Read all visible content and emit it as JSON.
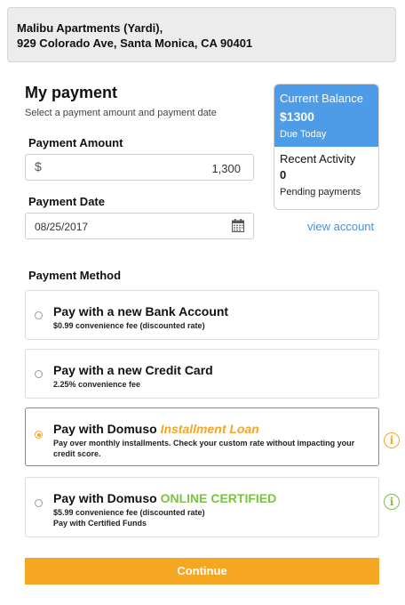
{
  "property": {
    "line1": "Malibu Apartments (Yardi),",
    "line2": "929 Colorado Ave, Santa Monica, CA 90401"
  },
  "payment": {
    "title": "My payment",
    "subtitle": "Select a payment amount and payment date",
    "amount_label": "Payment Amount",
    "currency_symbol": "$",
    "amount_value": "1,300",
    "date_label": "Payment Date",
    "date_value": "08/25/2017"
  },
  "balance": {
    "current_label": "Current Balance",
    "current_value": "$1300",
    "due_text": "Due Today",
    "recent_label": "Recent Activity",
    "recent_value": "0",
    "pending_text": "Pending payments",
    "view_link": "view account"
  },
  "method": {
    "label": "Payment Method",
    "options": [
      {
        "title": "Pay with a new Bank Account",
        "desc": "$0.99 convenience fee (discounted rate)",
        "selected": false
      },
      {
        "title": "Pay with a new Credit Card",
        "desc": "2.25% convenience fee",
        "selected": false
      },
      {
        "title_prefix": "Pay with Domuso",
        "title_highlight": "Installment Loan",
        "desc": "Pay over monthly installments. Check your custom rate without impacting your credit score.",
        "selected": true
      },
      {
        "title_prefix": "Pay with Domuso",
        "title_highlight": "ONLINE CERTIFIED",
        "desc_line1": "$5.99 convenience fee (discounted rate)",
        "desc_line2": "Pay with Certified Funds",
        "selected": false
      }
    ],
    "info_glyph": "i"
  },
  "continue_label": "Continue",
  "colors": {
    "accent_orange": "#f5a623",
    "accent_blue": "#4e9be8",
    "accent_green": "#7cc242",
    "link_blue": "#4a90d9"
  }
}
